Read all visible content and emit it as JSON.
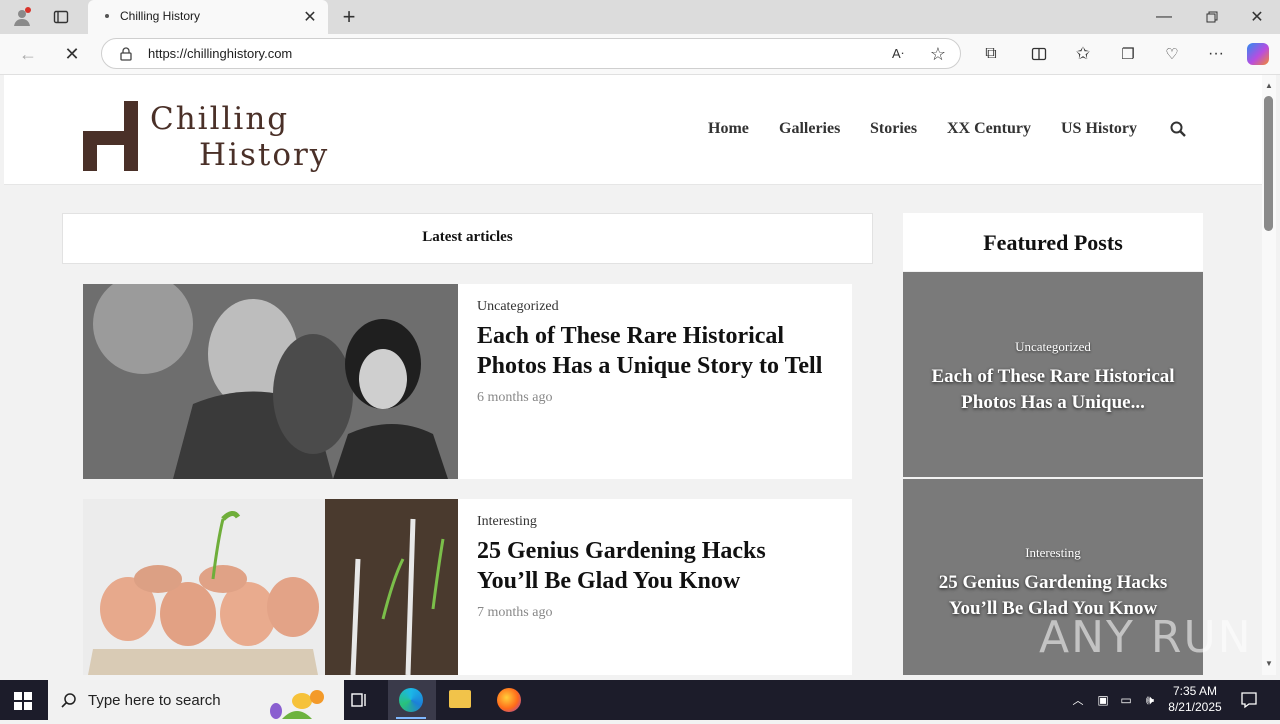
{
  "browser": {
    "tab_title": "Chilling History",
    "url": "https://chillinghistory.com",
    "icons": [
      "profile-icon",
      "tab-actions-icon",
      "close-tab-icon",
      "new-tab-icon",
      "back-icon",
      "reload-icon",
      "site-info-icon",
      "read-aloud-icon",
      "favorite-icon",
      "extensions-icon",
      "split-screen-icon",
      "favorites-icon",
      "collections-icon",
      "browser-essentials-icon",
      "more-icon",
      "copilot-icon",
      "minimize-icon",
      "restore-icon",
      "close-window-icon"
    ]
  },
  "site": {
    "logo_line1": "Chilling",
    "logo_line2": "History",
    "nav": [
      "Home",
      "Galleries",
      "Stories",
      "XX Century",
      "US History"
    ],
    "latest_heading": "Latest articles",
    "articles": [
      {
        "category": "Uncategorized",
        "title": "Each of These Rare Historical Photos Has a Unique Story to Tell",
        "date": "6 months ago"
      },
      {
        "category": "Interesting",
        "title": "25 Genius Gardening Hacks You’ll Be Glad You Know",
        "date": "7 months ago"
      }
    ],
    "featured_heading": "Featured Posts",
    "featured": [
      {
        "category": "Uncategorized",
        "title": "Each of These Rare Historical Photos Has a Unique..."
      },
      {
        "category": "Interesting",
        "title": "25 Genius Gardening Hacks You’ll Be Glad You Know"
      }
    ],
    "watermark": "ANY RUN"
  },
  "taskbar": {
    "search_placeholder": "Type here to search",
    "time": "7:35 AM",
    "date": "8/21/2025"
  },
  "colors": {
    "logo": "#4a3028",
    "taskbar": "#1c1c2a",
    "featured_bg": "#7a7a7a"
  }
}
